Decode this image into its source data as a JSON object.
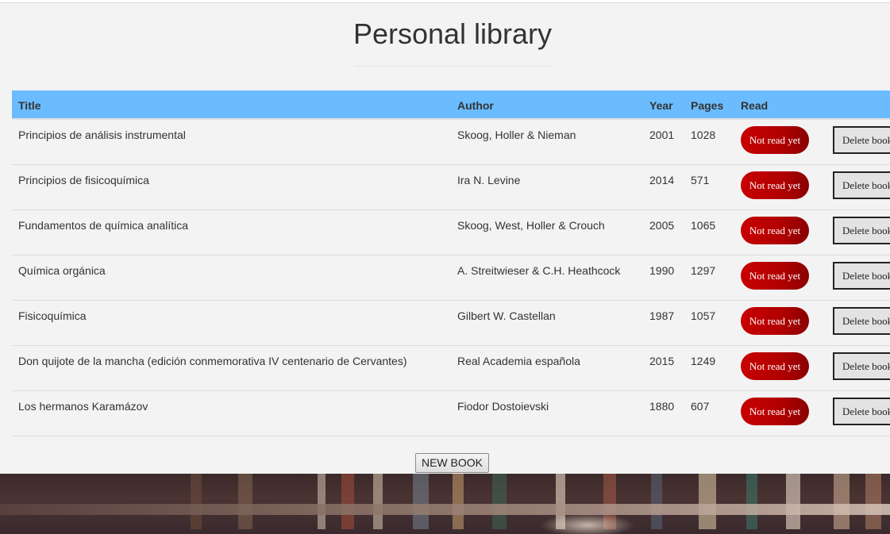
{
  "page": {
    "title": "Personal library"
  },
  "table": {
    "headers": {
      "title": "Title",
      "author": "Author",
      "year": "Year",
      "pages": "Pages",
      "read": "Read"
    },
    "rows": [
      {
        "title": "Principios de análisis instrumental",
        "author": "Skoog, Holler & Nieman",
        "year": "2001",
        "pages": "1028",
        "read_label": "Not read yet",
        "delete_label": "Delete book"
      },
      {
        "title": "Principios de fisicoquímica",
        "author": "Ira N. Levine",
        "year": "2014",
        "pages": "571",
        "read_label": "Not read yet",
        "delete_label": "Delete book"
      },
      {
        "title": "Fundamentos de química analítica",
        "author": "Skoog, West, Holler & Crouch",
        "year": "2005",
        "pages": "1065",
        "read_label": "Not read yet",
        "delete_label": "Delete book"
      },
      {
        "title": "Química orgánica",
        "author": "A. Streitwieser & C.H. Heathcock",
        "year": "1990",
        "pages": "1297",
        "read_label": "Not read yet",
        "delete_label": "Delete book"
      },
      {
        "title": "Fisicoquímica",
        "author": "Gilbert W. Castellan",
        "year": "1987",
        "pages": "1057",
        "read_label": "Not read yet",
        "delete_label": "Delete book"
      },
      {
        "title": "Don quijote de la mancha (edición conmemorativa IV centenario de Cervantes)",
        "author": "Real Academia española",
        "year": "2015",
        "pages": "1249",
        "read_label": "Not read yet",
        "delete_label": "Delete book"
      },
      {
        "title": "Los hermanos Karamázov",
        "author": "Fiodor Dostoievski",
        "year": "1880",
        "pages": "607",
        "read_label": "Not read yet",
        "delete_label": "Delete book"
      }
    ]
  },
  "actions": {
    "new_book_label": "NEW BOOK"
  },
  "colors": {
    "header_bg": "#6bbcff",
    "read_button": "#b00000",
    "panel_bg": "#f3f3f3"
  }
}
